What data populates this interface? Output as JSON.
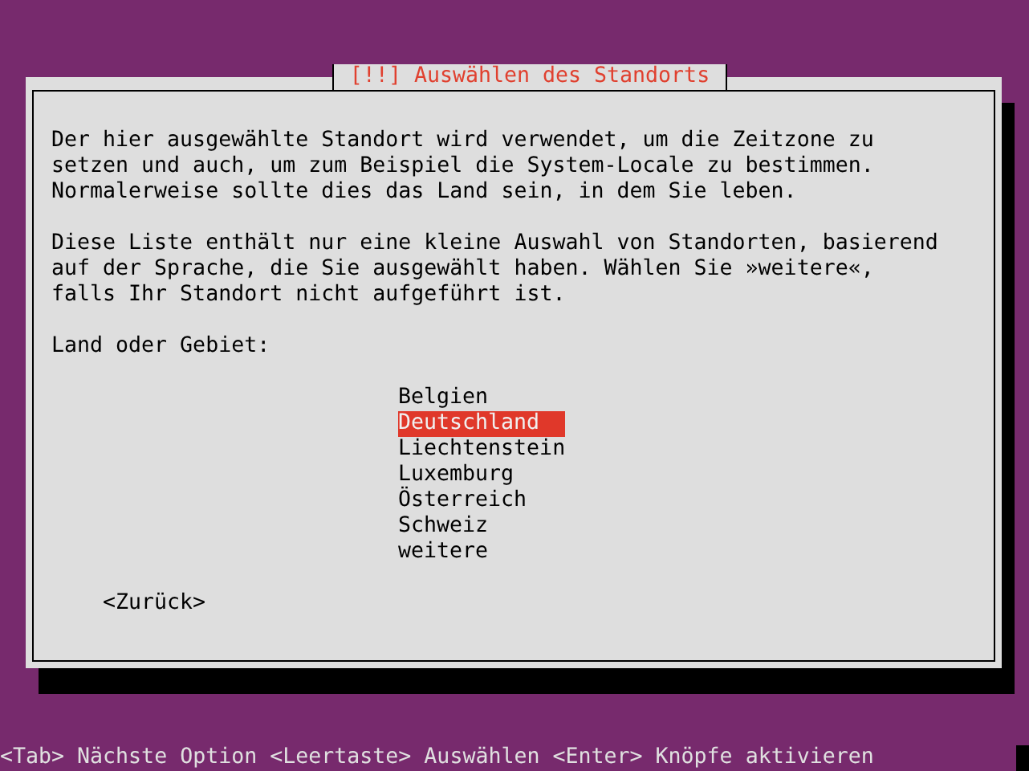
{
  "dialog": {
    "title": "[!!] Auswählen des Standorts",
    "paragraphs": [
      "Der hier ausgewählte Standort wird verwendet, um die Zeitzone zu\nsetzen und auch, um zum Beispiel die System-Locale zu bestimmen.\nNormalerweise sollte dies das Land sein, in dem Sie leben.",
      "Diese Liste enthält nur eine kleine Auswahl von Standorten, basierend\nauf der Sprache, die Sie ausgewählt haben. Wählen Sie »weitere«,\nfalls Ihr Standort nicht aufgeführt ist."
    ],
    "prompt": "Land oder Gebiet:",
    "options": [
      {
        "label": "Belgien",
        "selected": false
      },
      {
        "label": "Deutschland",
        "selected": true
      },
      {
        "label": "Liechtenstein",
        "selected": false
      },
      {
        "label": "Luxemburg",
        "selected": false
      },
      {
        "label": "Österreich",
        "selected": false
      },
      {
        "label": "Schweiz",
        "selected": false
      },
      {
        "label": "weitere",
        "selected": false
      }
    ],
    "back_button": "<Zurück>"
  },
  "help_bar": "<Tab> Nächste Option <Leertaste> Auswählen <Enter> Knöpfe aktivieren"
}
